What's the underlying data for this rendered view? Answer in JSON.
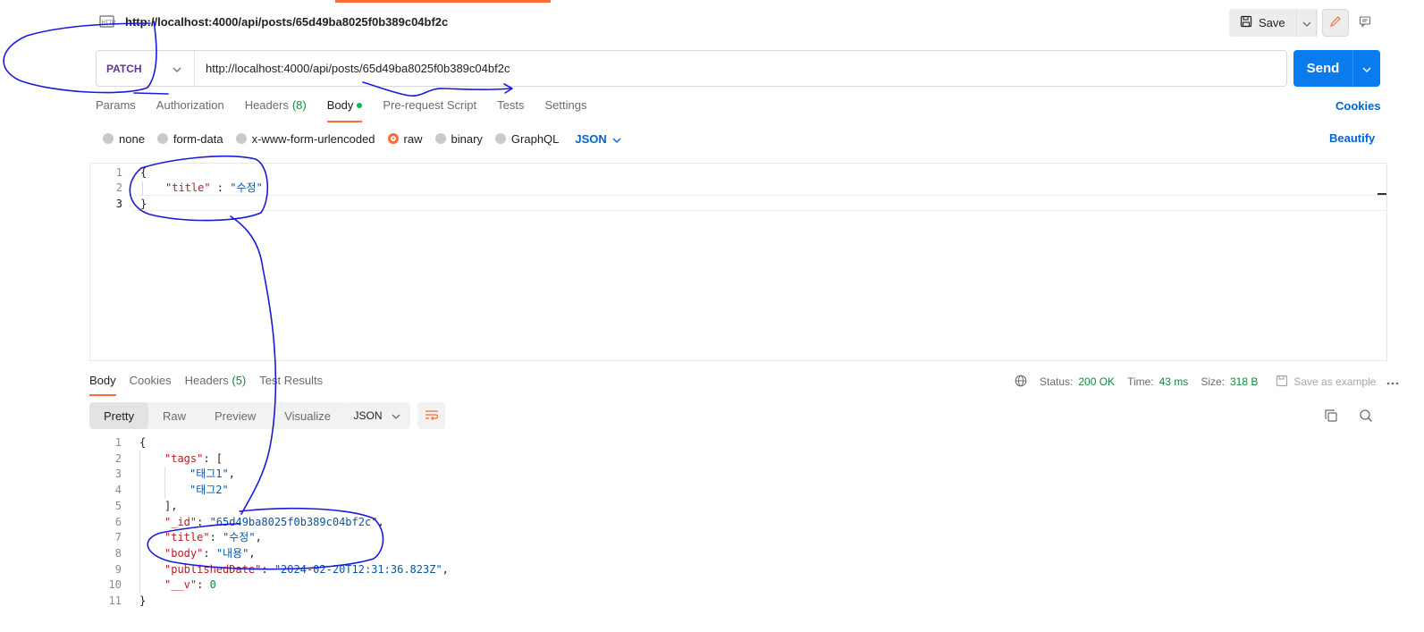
{
  "request": {
    "title": "http://localhost:4000/api/posts/65d49ba8025f0b389c04bf2c",
    "method": "PATCH",
    "url": "http://localhost:4000/api/posts/65d49ba8025f0b389c04bf2c",
    "save_label": "Save",
    "send_label": "Send",
    "tabs": [
      {
        "label": "Params"
      },
      {
        "label": "Authorization"
      },
      {
        "label": "Headers",
        "count": "(8)"
      },
      {
        "label": "Body",
        "active": true
      },
      {
        "label": "Pre-request Script"
      },
      {
        "label": "Tests"
      },
      {
        "label": "Settings"
      }
    ],
    "cookies_label": "Cookies",
    "body_types": [
      "none",
      "form-data",
      "x-www-form-urlencoded",
      "raw",
      "binary",
      "GraphQL"
    ],
    "selected_body_type": "raw",
    "language": "JSON",
    "beautify_label": "Beautify",
    "body_lines": [
      "1",
      "2",
      "3"
    ],
    "body_code": {
      "open": "{",
      "key": "\"title\"",
      "sep": " : ",
      "value": "\"수정\"",
      "close": "}"
    }
  },
  "response": {
    "tabs": [
      {
        "label": "Body",
        "active": true
      },
      {
        "label": "Cookies"
      },
      {
        "label": "Headers",
        "count": "(5)"
      },
      {
        "label": "Test Results"
      }
    ],
    "status_label": "Status:",
    "status_value": "200 OK",
    "time_label": "Time:",
    "time_value": "43 ms",
    "size_label": "Size:",
    "size_value": "318 B",
    "save_example_label": "Save as example",
    "view_modes": [
      "Pretty",
      "Raw",
      "Preview",
      "Visualize"
    ],
    "format": "JSON",
    "lines": [
      "1",
      "2",
      "3",
      "4",
      "5",
      "6",
      "7",
      "8",
      "9",
      "10",
      "11"
    ],
    "code": {
      "l1": "{",
      "tags_key": "\"tags\"",
      "tag1": "\"태그1\"",
      "tag2": "\"태그2\"",
      "id_key": "\"_id\"",
      "id_value": "\"65d49ba8025f0b389c04bf2c\"",
      "title_key": "\"title\"",
      "title_value": "\"수정\"",
      "body_key": "\"body\"",
      "body_value": "\"내용\"",
      "date_key": "\"publishedDate\"",
      "date_value": "\"2024-02-20T12:31:36.823Z\"",
      "v_key": "\"__v\"",
      "v_value": "0",
      "l11": "}"
    }
  },
  "colors": {
    "accent": "#ff6c37",
    "send": "#097bed",
    "method": "#623497",
    "link": "#0265d2",
    "status_ok": "#0f8a3e",
    "annotation_ink": "#1a1adb"
  },
  "icons": [
    "http-request-icon",
    "save-icon",
    "chevron-down-icon",
    "edit-icon",
    "comment-icon",
    "globe-icon",
    "save-example-icon",
    "more-icon",
    "wrap-icon",
    "copy-icon",
    "search-icon"
  ]
}
